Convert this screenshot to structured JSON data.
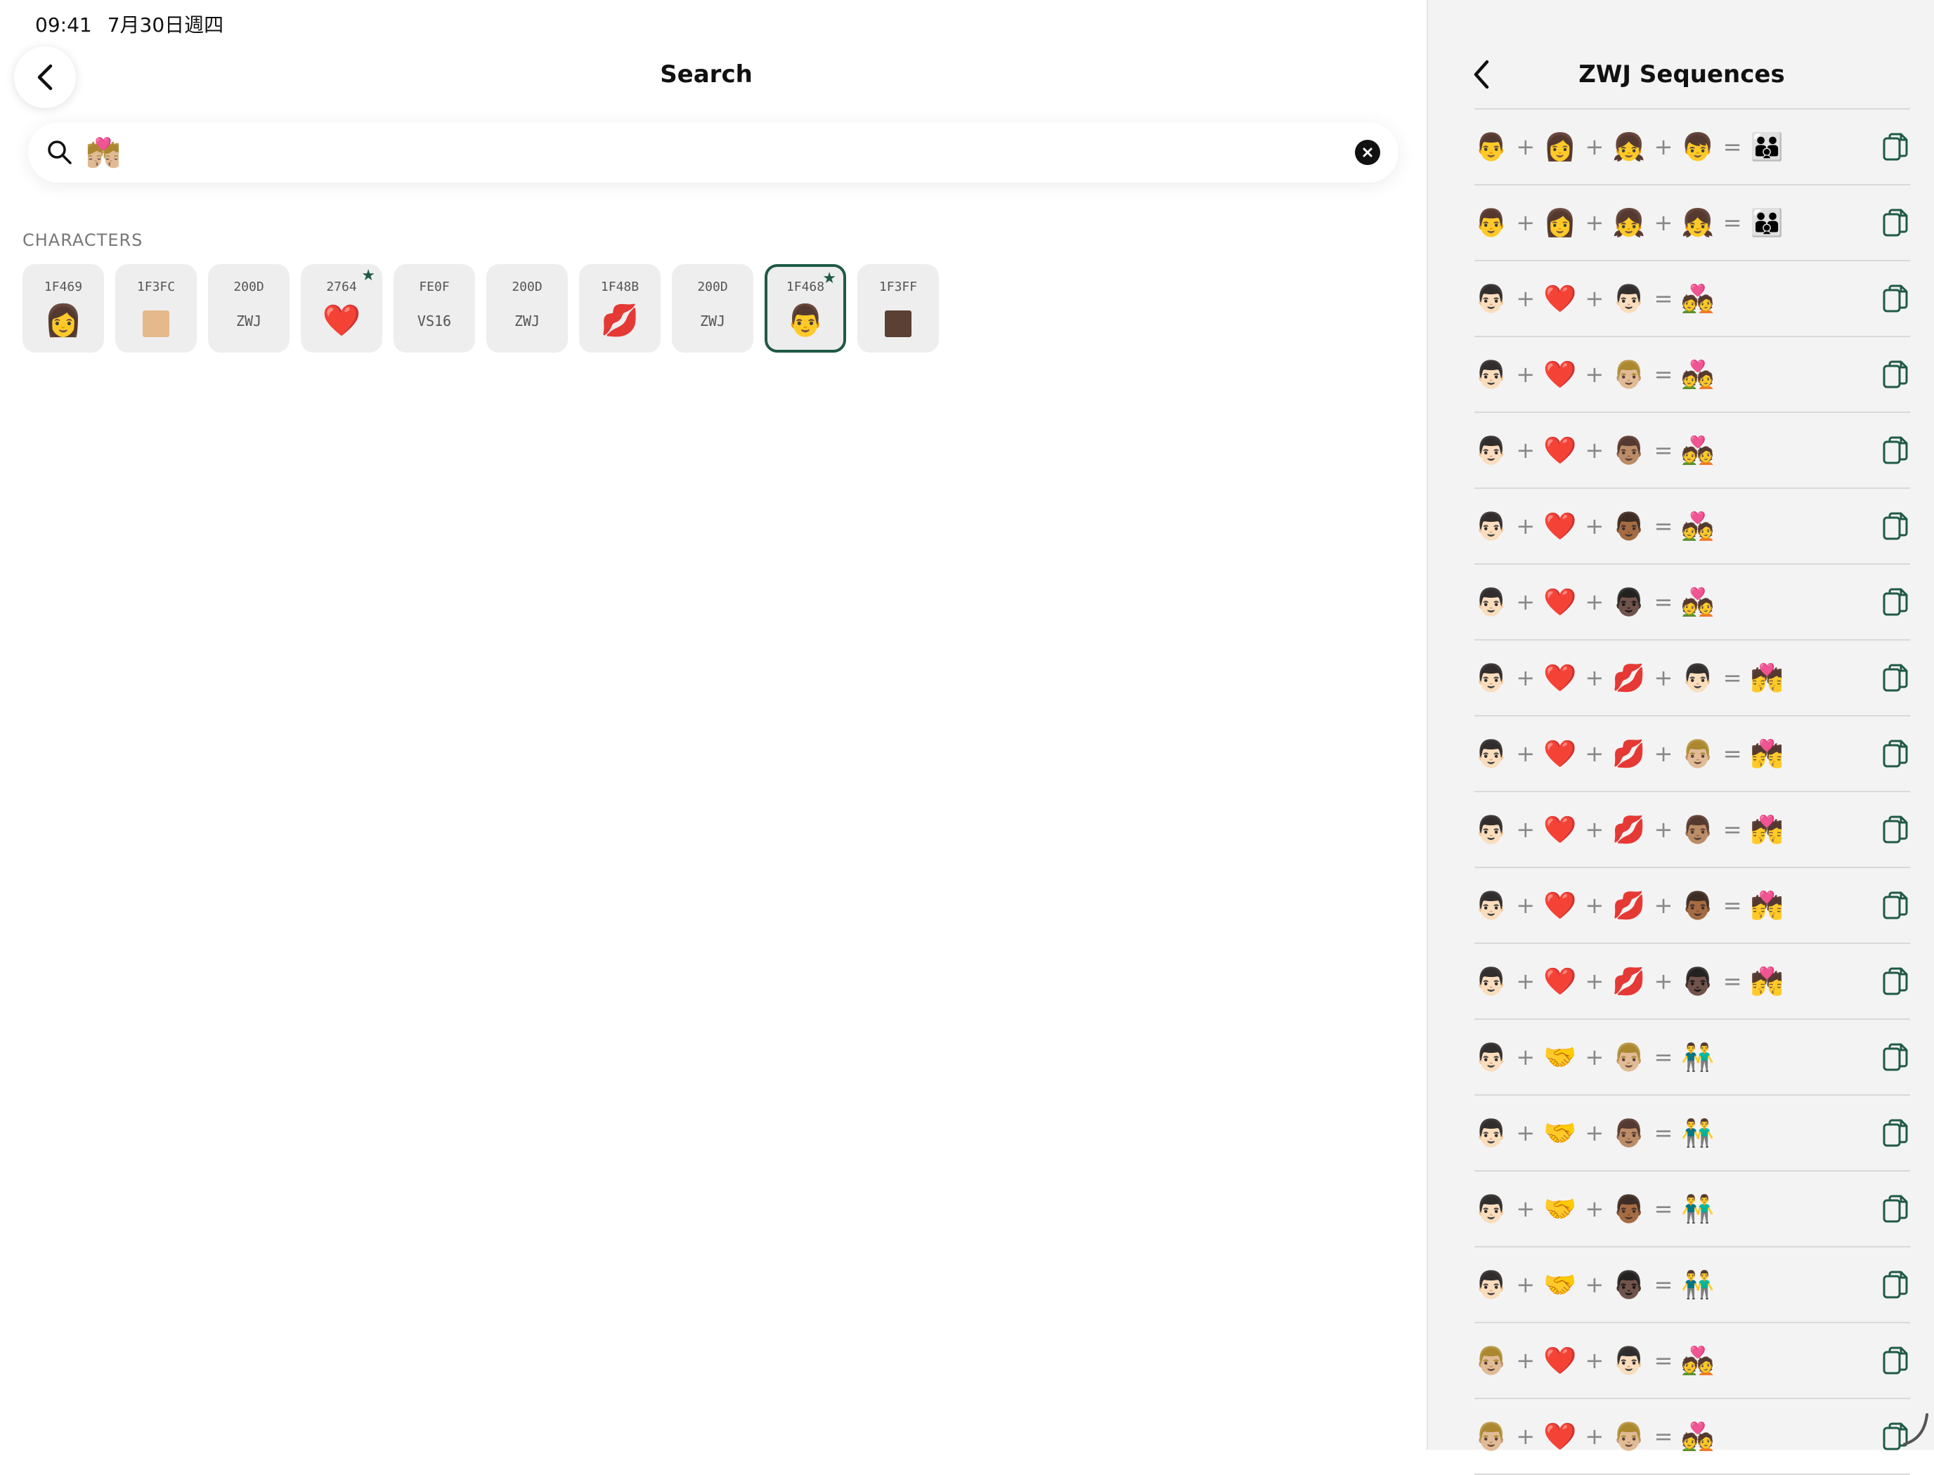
{
  "status_bar": {
    "time": "09:41",
    "date": "7月30日週四"
  },
  "header": {
    "title": "Search"
  },
  "search": {
    "value": "💏🏼",
    "placeholder": ""
  },
  "characters": {
    "section_label": "CHARACTERS",
    "items": [
      {
        "code": "1F469",
        "glyph": "👩",
        "starred": false,
        "selected": false
      },
      {
        "code": "1F3FC",
        "swatch": "#e5b98c",
        "starred": false,
        "selected": false
      },
      {
        "code": "200D",
        "text": "ZWJ",
        "starred": false,
        "selected": false
      },
      {
        "code": "2764",
        "glyph": "❤️",
        "starred": true,
        "selected": false
      },
      {
        "code": "FE0F",
        "text": "VS16",
        "starred": false,
        "selected": false
      },
      {
        "code": "200D",
        "text": "ZWJ",
        "starred": false,
        "selected": false
      },
      {
        "code": "1F48B",
        "glyph": "💋",
        "starred": false,
        "selected": false
      },
      {
        "code": "200D",
        "text": "ZWJ",
        "starred": false,
        "selected": false
      },
      {
        "code": "1F468",
        "glyph": "👨",
        "starred": true,
        "selected": true
      },
      {
        "code": "1F3FF",
        "swatch": "#5b4034",
        "starred": false,
        "selected": false
      }
    ]
  },
  "panel": {
    "title": "ZWJ Sequences",
    "rows": [
      {
        "parts": [
          "👨",
          "👩",
          "👧",
          "👦"
        ],
        "result": "👪"
      },
      {
        "parts": [
          "👨",
          "👩",
          "👧",
          "👧"
        ],
        "result": "👪"
      },
      {
        "parts": [
          "👨🏻",
          "❤️",
          "👨🏻"
        ],
        "result": "💑"
      },
      {
        "parts": [
          "👨🏻",
          "❤️",
          "👨🏼"
        ],
        "result": "💑"
      },
      {
        "parts": [
          "👨🏻",
          "❤️",
          "👨🏽"
        ],
        "result": "💑"
      },
      {
        "parts": [
          "👨🏻",
          "❤️",
          "👨🏾"
        ],
        "result": "💑"
      },
      {
        "parts": [
          "👨🏻",
          "❤️",
          "👨🏿"
        ],
        "result": "💑"
      },
      {
        "parts": [
          "👨🏻",
          "❤️",
          "💋",
          "👨🏻"
        ],
        "result": "💏"
      },
      {
        "parts": [
          "👨🏻",
          "❤️",
          "💋",
          "👨🏼"
        ],
        "result": "💏"
      },
      {
        "parts": [
          "👨🏻",
          "❤️",
          "💋",
          "👨🏽"
        ],
        "result": "💏"
      },
      {
        "parts": [
          "👨🏻",
          "❤️",
          "💋",
          "👨🏾"
        ],
        "result": "💏"
      },
      {
        "parts": [
          "👨🏻",
          "❤️",
          "💋",
          "👨🏿"
        ],
        "result": "💏"
      },
      {
        "parts": [
          "👨🏻",
          "🤝",
          "👨🏼"
        ],
        "result": "👬"
      },
      {
        "parts": [
          "👨🏻",
          "🤝",
          "👨🏽"
        ],
        "result": "👬"
      },
      {
        "parts": [
          "👨🏻",
          "🤝",
          "👨🏾"
        ],
        "result": "👬"
      },
      {
        "parts": [
          "👨🏻",
          "🤝",
          "👨🏿"
        ],
        "result": "👬"
      },
      {
        "parts": [
          "👨🏼",
          "❤️",
          "👨🏻"
        ],
        "result": "💑"
      },
      {
        "parts": [
          "👨🏼",
          "❤️",
          "👨🏼"
        ],
        "result": "💑"
      }
    ]
  },
  "colors": {
    "accent": "#1f5a45",
    "tile_bg": "#eeeeee",
    "panel_bg": "#f3f3f3"
  },
  "icons": {
    "back": "chevron-left-icon",
    "search": "magnifier-icon",
    "clear": "x-circle-icon",
    "copy": "copy-icon",
    "star": "star-icon"
  }
}
